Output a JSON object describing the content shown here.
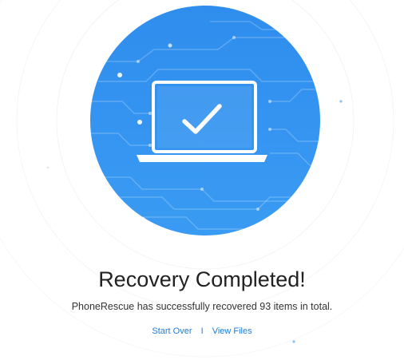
{
  "result": {
    "title": "Recovery Completed!",
    "message": "PhoneRescue has successfully recovered 93 items in total."
  },
  "actions": {
    "start_over": "Start Over",
    "separator": "I",
    "view_files": "View Files"
  },
  "illustration": {
    "icon": "laptop-check-icon",
    "circle_color": "#2f8ded",
    "accent_color": "#ffffff"
  },
  "link_color": "#1f7ed8"
}
